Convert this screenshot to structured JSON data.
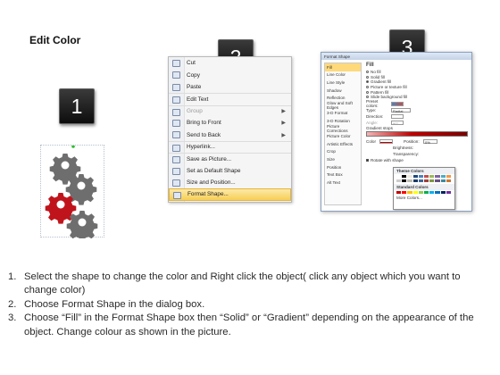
{
  "title": "Edit Color",
  "badges": [
    "1",
    "2",
    "3"
  ],
  "context_menu": {
    "items": [
      {
        "label": "Cut",
        "disabled": false,
        "submenu": false
      },
      {
        "label": "Copy",
        "disabled": false,
        "submenu": false
      },
      {
        "label": "Paste",
        "disabled": false,
        "submenu": false
      },
      {
        "label": "Edit Text",
        "disabled": false,
        "submenu": false
      },
      {
        "label": "Group",
        "disabled": true,
        "submenu": true
      },
      {
        "label": "Bring to Front",
        "disabled": false,
        "submenu": true
      },
      {
        "label": "Send to Back",
        "disabled": false,
        "submenu": true
      },
      {
        "label": "Hyperlink...",
        "disabled": false,
        "submenu": false
      },
      {
        "label": "Save as Picture...",
        "disabled": false,
        "submenu": false
      },
      {
        "label": "Set as Default Shape",
        "disabled": false,
        "submenu": false
      },
      {
        "label": "Size and Position...",
        "disabled": false,
        "submenu": false
      },
      {
        "label": "Format Shape...",
        "disabled": false,
        "submenu": false,
        "highlighted": true
      }
    ]
  },
  "format_dialog": {
    "title": "Format Shape",
    "sidebar": [
      "Fill",
      "Line Color",
      "Line Style",
      "Shadow",
      "Reflection",
      "Glow and Soft Edges",
      "3-D Format",
      "3-D Rotation",
      "Picture Corrections",
      "Picture Color",
      "Artistic Effects",
      "Crop",
      "Size",
      "Position",
      "Text Box",
      "Alt Text"
    ],
    "section": "Fill",
    "fill_options": [
      "No fill",
      "Solid fill",
      "Gradient fill",
      "Picture or texture fill",
      "Pattern fill",
      "Slide background fill"
    ],
    "selected_fill": "Gradient fill",
    "preset_label": "Preset colors:",
    "type_label": "Type:",
    "type_value": "Radial",
    "direction_label": "Direction:",
    "angle_label": "Angle:",
    "angle_value": "90°",
    "stops_label": "Gradient stops",
    "color_label": "Color",
    "position_label": "Position:",
    "position_value": "0%",
    "brightness_label": "Brightness:",
    "transparency_label": "Transparency:",
    "rotate_label": "Rotate with shape",
    "palette": {
      "theme_title": "Theme Colors",
      "standard_title": "Standard Colors",
      "more": "More Colors...",
      "theme_colors": [
        "#ffffff",
        "#000000",
        "#eeece1",
        "#1f497d",
        "#4f81bd",
        "#c0504d",
        "#9bbb59",
        "#8064a2",
        "#4bacc6",
        "#f79646"
      ],
      "standard_colors": [
        "#c00000",
        "#ff0000",
        "#ffc000",
        "#ffff00",
        "#92d050",
        "#00b050",
        "#00b0f0",
        "#0070c0",
        "#002060",
        "#7030a0"
      ]
    }
  },
  "gears": {
    "colors": [
      "#6e6e6e",
      "#c0141c"
    ]
  },
  "instructions": [
    {
      "num": "1.",
      "text": "Select the shape to change the color and Right click the object( click any object which you want to change color)"
    },
    {
      "num": "2.",
      "text": "Choose Format Shape in the dialog box."
    },
    {
      "num": "3.",
      "text": "Choose “Fill” in the Format Shape box then “Solid” or “Gradient” depending on the appearance of the object. Change colour as shown in the picture."
    }
  ]
}
